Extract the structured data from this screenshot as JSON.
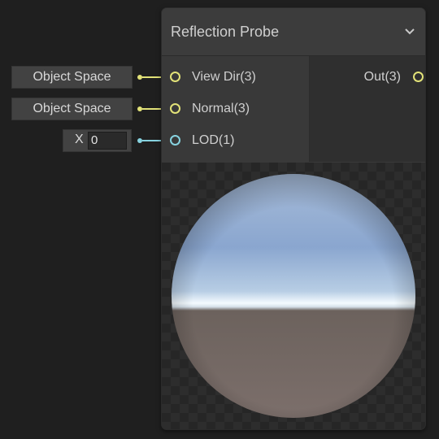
{
  "node": {
    "title": "Reflection Probe",
    "collapse_icon": "chevron-down-icon",
    "inputs": [
      {
        "label": "View Dir(3)",
        "type": "vector3",
        "color": "#e2e278"
      },
      {
        "label": "Normal(3)",
        "type": "vector3",
        "color": "#e2e278"
      },
      {
        "label": "LOD(1)",
        "type": "float",
        "color": "#87d3e0"
      }
    ],
    "outputs": [
      {
        "label": "Out(3)",
        "type": "vector3",
        "color": "#e2e278"
      }
    ]
  },
  "input_fields": {
    "view_dir_space": "Object Space",
    "normal_space": "Object Space",
    "lod_axis_label": "X",
    "lod_value": "0"
  },
  "colors": {
    "vector3_port": "#e2e278",
    "float_port": "#87d3e0",
    "node_body": "#393939",
    "canvas": "#1f1f1f"
  }
}
